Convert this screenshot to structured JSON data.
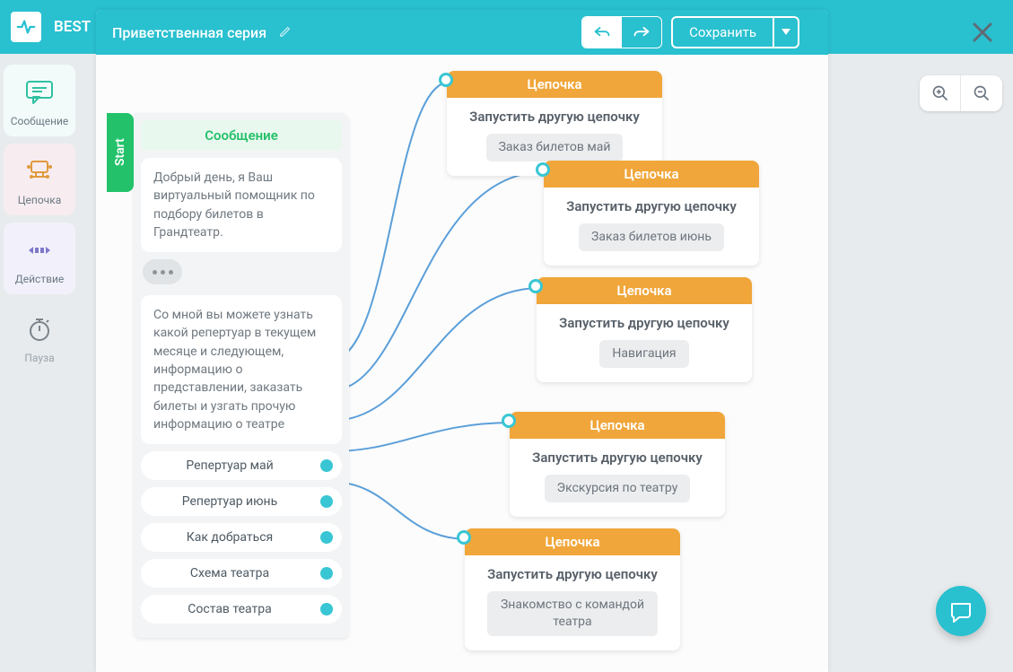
{
  "brand": {
    "name": "BEST"
  },
  "sidebar": {
    "items": [
      {
        "label": "Сообщение"
      },
      {
        "label": "Цепочка"
      },
      {
        "label": "Действие"
      },
      {
        "label": "Пауза"
      }
    ]
  },
  "editor": {
    "flow_name": "Приветственная серия",
    "save_label": "Сохранить"
  },
  "start_node": {
    "tab_label": "Start",
    "title": "Сообщение",
    "message1": "Добрый день, я Ваш виртуальный помощник по подбору билетов в Грандтеатр.",
    "message2": "Со мной вы можете узнать какой репертуар в текущем месяце и следующем, информацию о представлении, заказать билеты и узгать прочую информацию о театре",
    "quick_replies": [
      "Репертуар май",
      "Репертуар июнь",
      "Как добраться",
      "Схема театра",
      "Состав театра"
    ]
  },
  "chain_nodes": [
    {
      "head": "Цепочка",
      "title": "Запустить другую цепочку",
      "pill": "Заказ билетов май"
    },
    {
      "head": "Цепочка",
      "title": "Запустить другую цепочку",
      "pill": "Заказ билетов июнь"
    },
    {
      "head": "Цепочка",
      "title": "Запустить другую цепочку",
      "pill": "Навигация"
    },
    {
      "head": "Цепочка",
      "title": "Запустить другую цепочку",
      "pill": "Экскурсия по театру"
    },
    {
      "head": "Цепочка",
      "title": "Запустить другую цепочку",
      "pill": "Знакомство с командой театра"
    }
  ]
}
